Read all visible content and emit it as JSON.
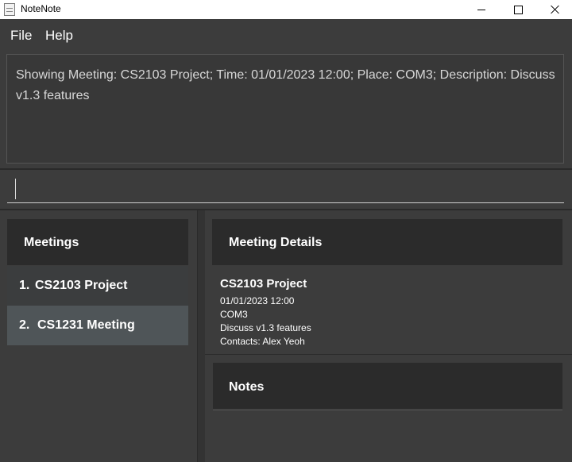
{
  "window": {
    "title": "NoteNote",
    "icon": "notepad-icon"
  },
  "menu": {
    "file_label": "File",
    "help_label": "Help"
  },
  "result_display": {
    "text": "Showing Meeting: CS2103 Project; Time: 01/01/2023 12:00; Place: COM3; Description: Discuss v1.3 features"
  },
  "command_box": {
    "value": "",
    "placeholder": ""
  },
  "meetings_panel": {
    "header": "Meetings",
    "items": [
      {
        "index": "1.",
        "name": "CS2103 Project"
      },
      {
        "index": "2.",
        "name": "CS1231 Meeting"
      }
    ]
  },
  "details_panel": {
    "header": "Meeting Details",
    "title": "CS2103 Project",
    "time": "01/01/2023 12:00",
    "place": "COM3",
    "description": "Discuss v1.3 features",
    "contacts": "Contacts: Alex Yeoh"
  },
  "notes_panel": {
    "header": "Notes"
  },
  "colors": {
    "background": "#3c3c3c",
    "header_background": "#2b2b2b",
    "selected_row": "#4f5558",
    "text": "#ffffff"
  }
}
